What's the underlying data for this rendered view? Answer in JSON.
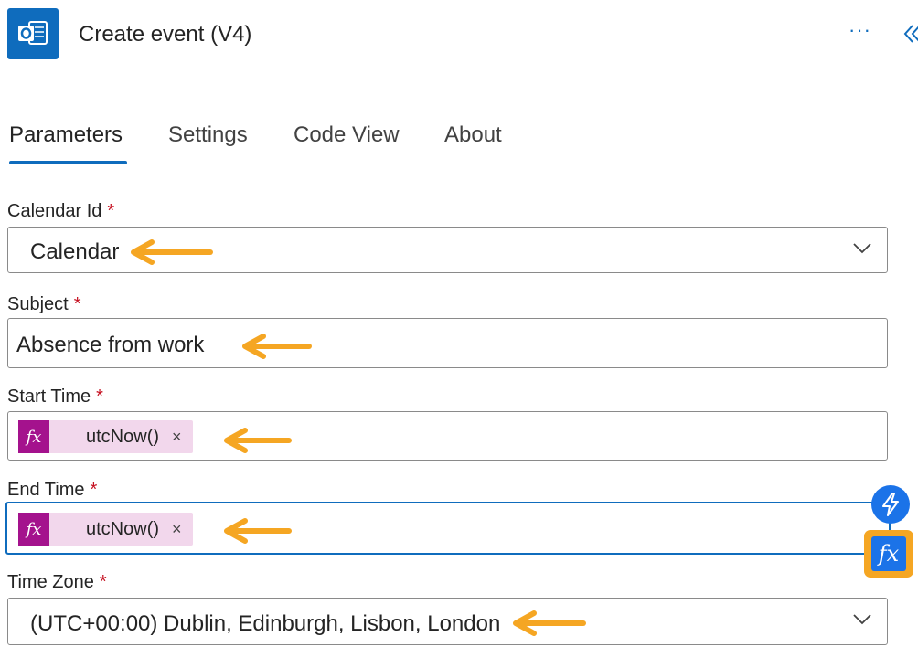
{
  "header": {
    "title": "Create event (V4)",
    "app_icon": "outlook-icon",
    "more_label": "···",
    "collapse_icon": "double-chevron-left-icon"
  },
  "tabs": [
    {
      "label": "Parameters",
      "active": true
    },
    {
      "label": "Settings",
      "active": false
    },
    {
      "label": "Code View",
      "active": false
    },
    {
      "label": "About",
      "active": false
    }
  ],
  "fields": {
    "calendar_id": {
      "label": "Calendar Id",
      "required": "*",
      "value": "Calendar",
      "type": "dropdown"
    },
    "subject": {
      "label": "Subject",
      "required": "*",
      "value": "Absence from work",
      "type": "text"
    },
    "start_time": {
      "label": "Start Time",
      "required": "*",
      "token_icon": "fx",
      "token_label": "utcNow()",
      "remove_label": "×"
    },
    "end_time": {
      "label": "End Time",
      "required": "*",
      "token_icon": "fx",
      "token_label": "utcNow()",
      "remove_label": "×",
      "focused": true
    },
    "time_zone": {
      "label": "Time Zone",
      "required": "*",
      "value": "(UTC+00:00) Dublin, Edinburgh, Lisbon, London",
      "type": "dropdown"
    }
  },
  "floating_buttons": {
    "dynamic_content_icon": "lightning-icon",
    "expression_label": "fx"
  },
  "colors": {
    "accent": "#0f6cbd",
    "required": "#c50f1f",
    "token_bg": "#f2d7ec",
    "token_icon_bg": "#a4128d",
    "annotation_arrow": "#f5a623"
  }
}
